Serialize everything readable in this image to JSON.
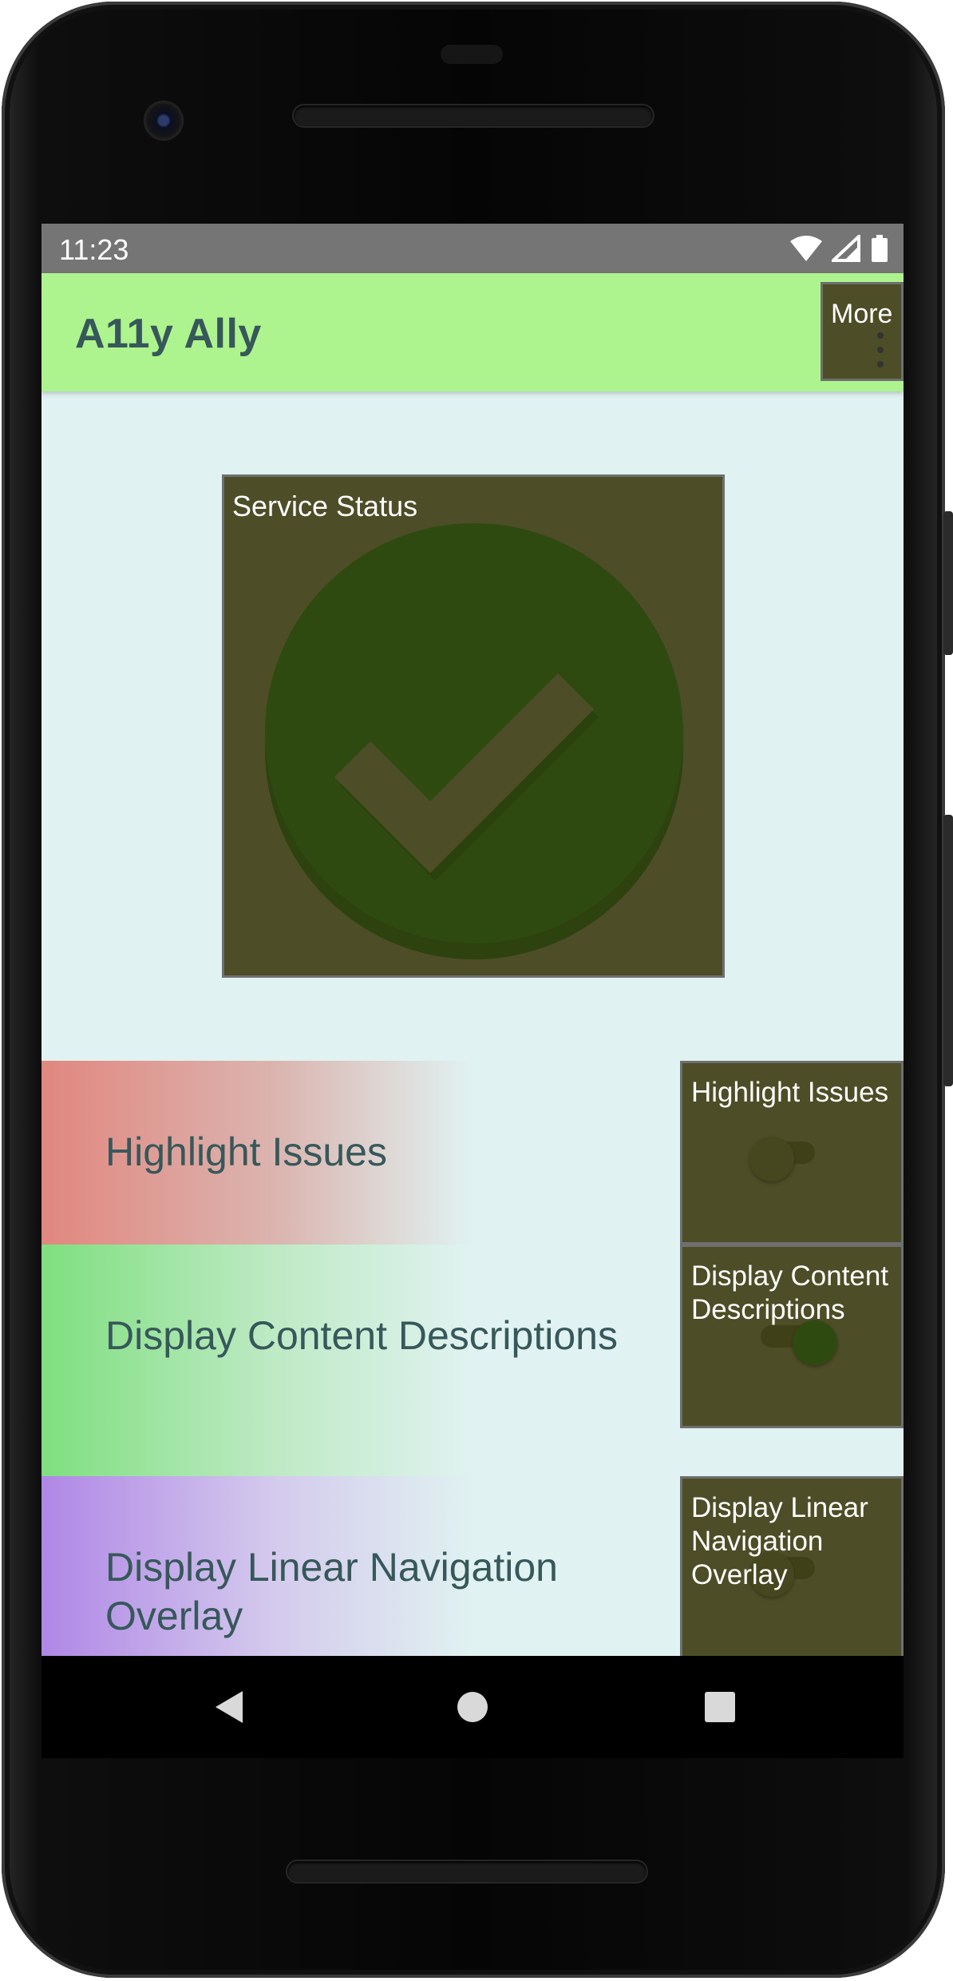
{
  "status_bar": {
    "time": "11:23",
    "icons": [
      "wifi-icon",
      "cellular-signal-icon",
      "battery-icon"
    ]
  },
  "app_bar": {
    "title": "A11y Ally",
    "more_button_label": "More",
    "background_color": "#aef48e",
    "title_color": "#37585a"
  },
  "service_status": {
    "label": "Service Status",
    "icon": "check-circle-icon",
    "icon_color": "#2f4a10"
  },
  "settings": [
    {
      "label": "Highlight Issues",
      "toggle_label": "Highlight Issues",
      "color": "#e1877f"
    },
    {
      "label": "Display Content Descriptions",
      "toggle_label": "Display Content Descriptions",
      "color": "#7fdf7f"
    },
    {
      "label": "Display Linear Navigation Overlay",
      "toggle_label": "Display Linear Navigation Overlay",
      "color": "#b087e6"
    }
  ],
  "nav_bar": {
    "icons": [
      "back-icon",
      "home-icon",
      "recents-icon"
    ]
  },
  "colors": {
    "screen_background": "#e0f2f1",
    "status_bar": "#757575",
    "overlay_box": "#4d4d27"
  }
}
